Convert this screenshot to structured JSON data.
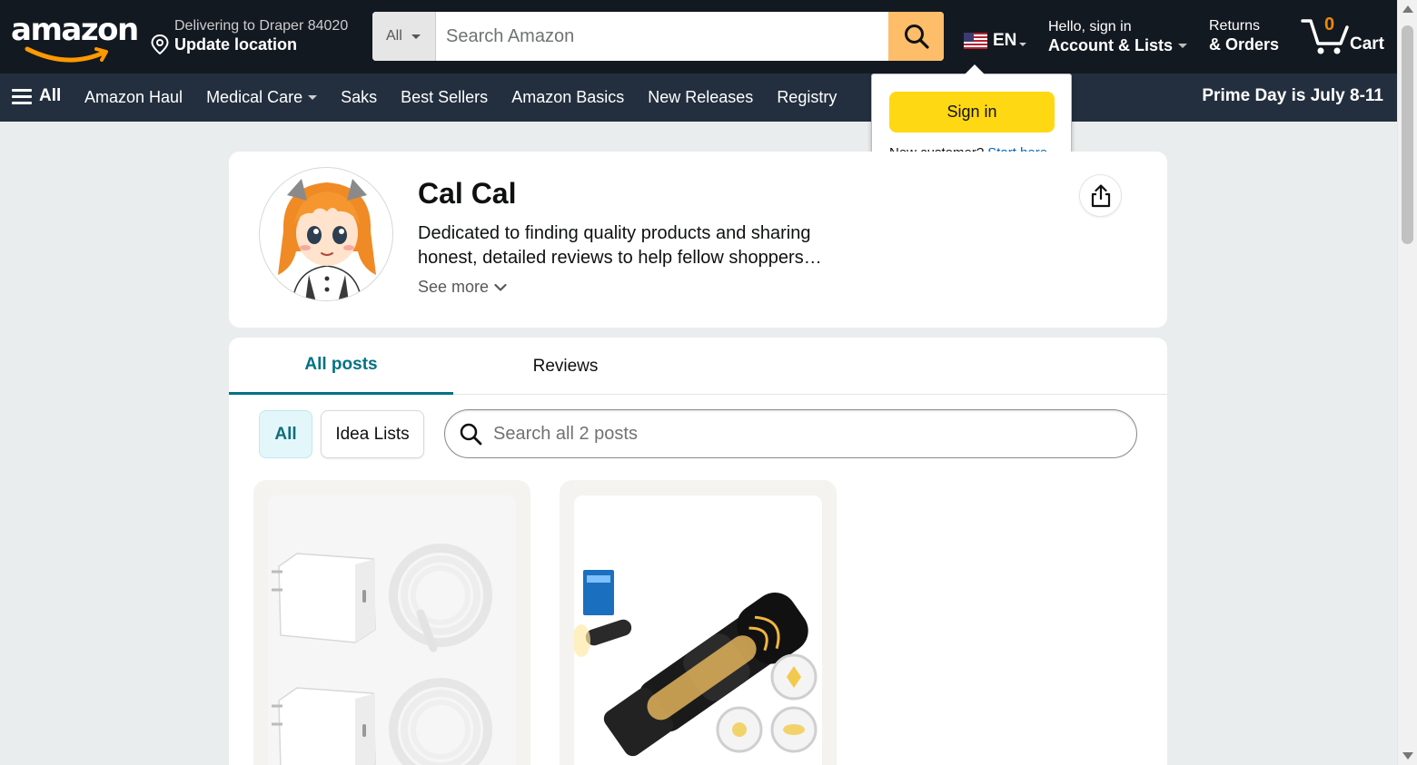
{
  "header": {
    "logo_text": "amazon",
    "delivery": {
      "line1": "Delivering to Draper 84020",
      "line2": "Update location"
    },
    "search": {
      "department": "All",
      "placeholder": "Search Amazon"
    },
    "language": {
      "code": "EN"
    },
    "account": {
      "line1": "Hello, sign in",
      "line2": "Account & Lists"
    },
    "returns": {
      "line1": "Returns",
      "line2": "& Orders"
    },
    "cart": {
      "count": "0",
      "label": "Cart"
    }
  },
  "subnav": {
    "all_label": "All",
    "items": [
      {
        "label": "Amazon Haul"
      },
      {
        "label": "Medical Care"
      },
      {
        "label": "Saks"
      },
      {
        "label": "Best Sellers"
      },
      {
        "label": "Amazon Basics"
      },
      {
        "label": "New Releases"
      },
      {
        "label": "Registry"
      }
    ],
    "promo": "Prime Day is July 8-11"
  },
  "signin_flyout": {
    "button_label": "Sign in",
    "new_customer_text": "New customer?",
    "start_link": "Start here."
  },
  "profile": {
    "name": "Cal Cal",
    "bio": "Dedicated to finding quality products and sharing honest, detailed reviews to help fellow shoppers…",
    "see_more": "See more"
  },
  "posts": {
    "tabs": [
      {
        "label": "All posts",
        "active": true
      },
      {
        "label": "Reviews",
        "active": false
      }
    ],
    "filters": [
      {
        "label": "All",
        "active": true
      },
      {
        "label": "Idea Lists",
        "active": false
      }
    ],
    "search_placeholder": "Search all 2 posts"
  },
  "colors": {
    "nav_top": "#131921",
    "nav_sub": "#232f3e",
    "search_button": "#febd69",
    "signin_button": "#ffd814",
    "cart_count": "#f08804",
    "link": "#0066c0",
    "tab_active": "#007185"
  }
}
